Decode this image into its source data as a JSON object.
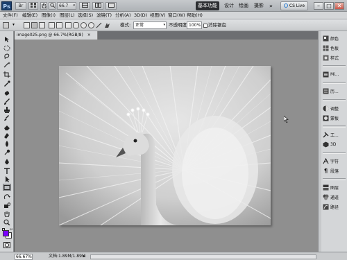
{
  "app": {
    "logo": "Ps",
    "bridge_btn": "Br",
    "zoom_dropdown": "66.7",
    "workspaces": {
      "active": "基本功能",
      "items": [
        "设计",
        "绘画",
        "摄影"
      ],
      "more": "»"
    },
    "cs_live": "CS Live",
    "window_buttons": {
      "minimize": "–",
      "restore": "□",
      "close": "✕"
    }
  },
  "menu": {
    "items": [
      "文件(F)",
      "编辑(E)",
      "图像(I)",
      "图层(L)",
      "选择(S)",
      "滤镜(T)",
      "分析(A)",
      "3D(D)",
      "视图(V)",
      "窗口(W)",
      "帮助(H)"
    ]
  },
  "options": {
    "style_label": "模式:",
    "style_value": "正常",
    "opacity_label": "不透明度:",
    "opacity_value": "100%",
    "antialias_label": "消除锯齿"
  },
  "document": {
    "tab_title": "image025.png @ 66.7%(RGB/8)",
    "tab_close": "×"
  },
  "status": {
    "zoom": "66.67%",
    "doc_info": "文档:1.89M/1.89M"
  },
  "panels": {
    "group1": [
      {
        "label": "颜色",
        "icon": "color-icon"
      },
      {
        "label": "色板",
        "icon": "swatches-icon"
      },
      {
        "label": "样式",
        "icon": "styles-icon"
      }
    ],
    "group2": [
      {
        "label": "Mi...",
        "icon": "mini-bridge-icon"
      }
    ],
    "group3": [
      {
        "label": "历...",
        "icon": "history-icon"
      }
    ],
    "group4": [
      {
        "label": "调整",
        "icon": "adjustments-icon"
      },
      {
        "label": "蒙板",
        "icon": "masks-icon"
      }
    ],
    "group5": [
      {
        "label": "工...",
        "icon": "tool-presets-icon"
      },
      {
        "label": "3D",
        "icon": "3d-icon"
      }
    ],
    "group6": [
      {
        "label": "字符",
        "icon": "character-icon"
      },
      {
        "label": "段落",
        "icon": "paragraph-icon"
      }
    ],
    "group7": [
      {
        "label": "图层",
        "icon": "layers-icon"
      },
      {
        "label": "通道",
        "icon": "channels-icon"
      },
      {
        "label": "路径",
        "icon": "paths-icon"
      }
    ]
  },
  "colors": {
    "foreground": "#7a00ff",
    "background": "#ffffff",
    "active_workspace": "#2c2e31"
  }
}
